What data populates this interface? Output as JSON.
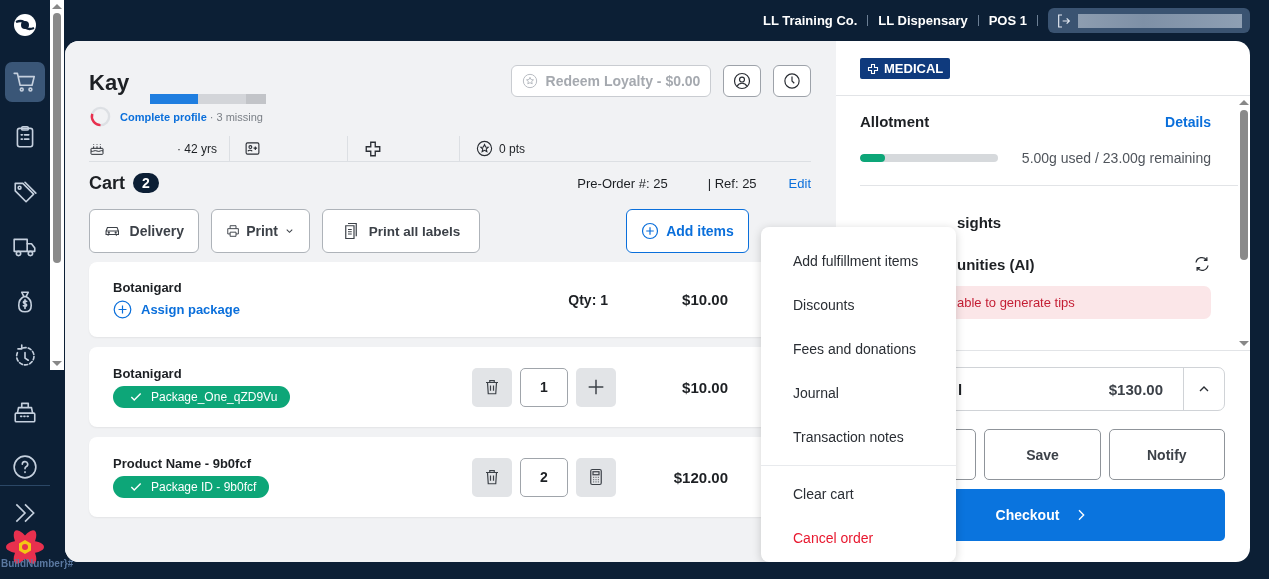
{
  "nav": {
    "items": [
      {
        "selected": true
      },
      {
        "selected": false
      },
      {
        "selected": false
      },
      {
        "selected": false
      },
      {
        "selected": false
      },
      {
        "selected": false
      },
      {
        "selected": false
      },
      {
        "selected": false
      }
    ],
    "build_label": "BuildNumber}#"
  },
  "topbar": {
    "org": "LL Training Co.",
    "store": "LL Dispensary",
    "register": "POS 1"
  },
  "customer": {
    "name": "Kay",
    "profile": {
      "link": "Complete profile",
      "note": "· 3 missing",
      "level": 0.3
    },
    "age": "· 42 yrs",
    "points": "0 pts",
    "loyalty_button": "Redeem Loyalty - $0.00"
  },
  "cart": {
    "title": "Cart",
    "count": "2",
    "preorder": "Pre-Order #: 25",
    "ref": "| Ref: 25",
    "edit": "Edit",
    "toolbar": [
      {
        "kind": "delivery",
        "label": "Delivery"
      },
      {
        "kind": "print",
        "label": "Print"
      },
      {
        "kind": "labels",
        "label": "Print all labels"
      }
    ],
    "add_items": "Add items",
    "items": [
      {
        "kind": "pending",
        "name": "Botanigard",
        "action": "Assign package",
        "qty": "Qty: 1",
        "price": "$10.00"
      },
      {
        "kind": "stepper",
        "name": "Botanigard",
        "package": "Package_One_qZD9Vu",
        "qty": "1",
        "price": "$10.00"
      },
      {
        "kind": "calculator",
        "name": "Product Name - 9b0fcf",
        "package": "Package ID - 9b0fcf",
        "qty": "2",
        "price": "$120.00"
      }
    ]
  },
  "menu": {
    "groups": [
      [
        {
          "label": "Add fulfillment items",
          "danger": false
        },
        {
          "label": "Discounts",
          "danger": false
        },
        {
          "label": "Fees and donations",
          "danger": false
        },
        {
          "label": "Journal",
          "danger": false
        },
        {
          "label": "Transaction notes",
          "danger": false
        }
      ],
      [
        {
          "label": "Clear cart",
          "danger": false
        },
        {
          "label": "Cancel order",
          "danger": true
        }
      ]
    ]
  },
  "side": {
    "badge": "MEDICAL",
    "allotment": {
      "title": "Allotment",
      "details": "Details",
      "level": 0.18,
      "reading": "5.00g used / 23.00g remaining"
    },
    "insights_title": "sights",
    "opportunities_title": "unities (AI)",
    "error": "able to generate tips",
    "total_label": "l",
    "total": "$130.00",
    "actions": [
      "Save",
      "Notify"
    ],
    "checkout": "Checkout"
  }
}
